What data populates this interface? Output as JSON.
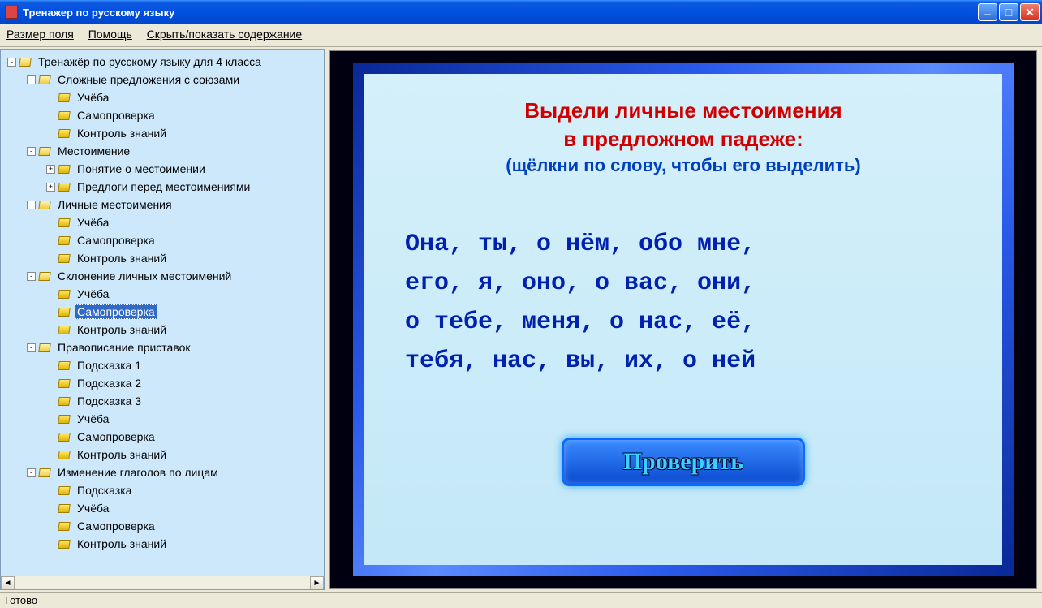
{
  "window": {
    "title": "Тренажер по русскому языку"
  },
  "menu": {
    "field_size": "Размер поля",
    "help": "Помощь",
    "toggle_toc": "Скрыть/показать содержание"
  },
  "tree": {
    "selected_path": "4.2",
    "nodes": [
      {
        "label": "Тренажёр по русскому языку для 4 класса",
        "depth": 0,
        "exp": "-",
        "open": true
      },
      {
        "label": "Сложные предложения с союзами",
        "depth": 1,
        "exp": "-",
        "open": true
      },
      {
        "label": "Учёба",
        "depth": 2,
        "exp": "",
        "open": false
      },
      {
        "label": "Самопроверка",
        "depth": 2,
        "exp": "",
        "open": false
      },
      {
        "label": "Контроль знаний",
        "depth": 2,
        "exp": "",
        "open": false
      },
      {
        "label": "Местоимение",
        "depth": 1,
        "exp": "-",
        "open": true
      },
      {
        "label": "Понятие о местоимении",
        "depth": 2,
        "exp": "+",
        "open": false
      },
      {
        "label": "Предлоги перед местоимениями",
        "depth": 2,
        "exp": "+",
        "open": false
      },
      {
        "label": "Личные местоимения",
        "depth": 1,
        "exp": "-",
        "open": true
      },
      {
        "label": "Учёба",
        "depth": 2,
        "exp": "",
        "open": false
      },
      {
        "label": "Самопроверка",
        "depth": 2,
        "exp": "",
        "open": false
      },
      {
        "label": "Контроль знаний",
        "depth": 2,
        "exp": "",
        "open": false
      },
      {
        "label": "Склонение личных местоимений",
        "depth": 1,
        "exp": "-",
        "open": true
      },
      {
        "label": "Учёба",
        "depth": 2,
        "exp": "",
        "open": false
      },
      {
        "label": "Самопроверка",
        "depth": 2,
        "exp": "",
        "open": false,
        "selected": true
      },
      {
        "label": "Контроль знаний",
        "depth": 2,
        "exp": "",
        "open": false
      },
      {
        "label": "Правописание приставок",
        "depth": 1,
        "exp": "-",
        "open": true
      },
      {
        "label": "Подсказка 1",
        "depth": 2,
        "exp": "",
        "open": false
      },
      {
        "label": "Подсказка 2",
        "depth": 2,
        "exp": "",
        "open": false
      },
      {
        "label": "Подсказка 3",
        "depth": 2,
        "exp": "",
        "open": false
      },
      {
        "label": "Учёба",
        "depth": 2,
        "exp": "",
        "open": false
      },
      {
        "label": "Самопроверка",
        "depth": 2,
        "exp": "",
        "open": false
      },
      {
        "label": "Контроль знаний",
        "depth": 2,
        "exp": "",
        "open": false
      },
      {
        "label": "Изменение глаголов по лицам",
        "depth": 1,
        "exp": "-",
        "open": true
      },
      {
        "label": "Подсказка",
        "depth": 2,
        "exp": "",
        "open": false
      },
      {
        "label": "Учёба",
        "depth": 2,
        "exp": "",
        "open": false
      },
      {
        "label": "Самопроверка",
        "depth": 2,
        "exp": "",
        "open": false
      },
      {
        "label": "Контроль знаний",
        "depth": 2,
        "exp": "",
        "open": false
      }
    ]
  },
  "exercise": {
    "instruction_line1": "Выдели личные местоимения",
    "instruction_line2": "в предложном падеже:",
    "hint": "(щёлкни по слову, чтобы его выделить)",
    "words_line1": "Она, ты, о нём, обо мне,",
    "words_line2": "его, я, оно, о вас, они,",
    "words_line3": "о тебе, меня, о нас, её,",
    "words_line4": "тебя, нас, вы, их, о ней",
    "check_button": "Проверить"
  },
  "status": {
    "text": "Готово"
  }
}
